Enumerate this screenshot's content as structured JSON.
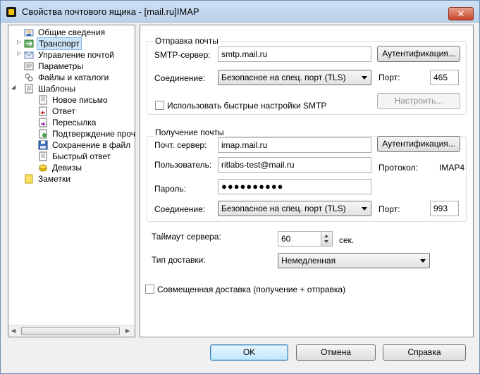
{
  "window": {
    "title": "Свойства почтового ящика - [mail.ru]IMAP",
    "close_label": "✕"
  },
  "tree": {
    "items": [
      {
        "label": "Общие сведения"
      },
      {
        "label": "Транспорт"
      },
      {
        "label": "Управление почтой"
      },
      {
        "label": "Параметры"
      },
      {
        "label": "Файлы и каталоги"
      },
      {
        "label": "Шаблоны"
      },
      {
        "label": "Новое письмо"
      },
      {
        "label": "Ответ"
      },
      {
        "label": "Пересылка"
      },
      {
        "label": "Подтверждение проч"
      },
      {
        "label": "Сохранение в файл"
      },
      {
        "label": "Быстрый ответ"
      },
      {
        "label": "Девизы"
      },
      {
        "label": "Заметки"
      }
    ]
  },
  "send": {
    "group_title": "Отправка почты",
    "server_label": "SMTP-сервер:",
    "server_value": "smtp.mail.ru",
    "auth_button": "Аутентификация...",
    "connection_label": "Соединение:",
    "connection_value": "Безопасное на спец. порт (TLS)",
    "port_label": "Порт:",
    "port_value": "465",
    "quick_smtp_label": "Использовать быстрые настройки SMTP",
    "configure_button": "Настроить..."
  },
  "receive": {
    "group_title": "Получение почты",
    "server_label": "Почт. сервер:",
    "server_value": "imap.mail.ru",
    "auth_button": "Аутентификация...",
    "user_label": "Пользователь:",
    "user_value": "ritlabs-test@mail.ru",
    "protocol_label": "Протокол:",
    "protocol_value": "IMAP4",
    "password_label": "Пароль:",
    "password_value": "●●●●●●●●●●",
    "connection_label": "Соединение:",
    "connection_value": "Безопасное на спец. порт (TLS)",
    "port_label": "Порт:",
    "port_value": "993"
  },
  "timeout": {
    "label": "Таймаут сервера:",
    "value": "60",
    "unit": "сек."
  },
  "delivery": {
    "label": "Тип доставки:",
    "value": "Немедленная"
  },
  "combined": {
    "label": "Совмещенная доставка (получение + отправка)"
  },
  "footer": {
    "ok": "OK",
    "cancel": "Отмена",
    "help": "Справка"
  }
}
